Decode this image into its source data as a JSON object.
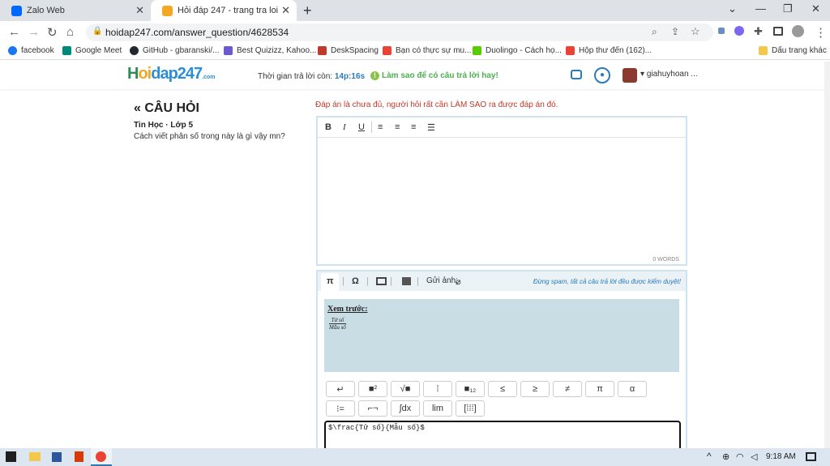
{
  "tabs": [
    {
      "title": "Zalo Web",
      "close": "✕"
    },
    {
      "title": "Hỏi đáp 247 - trang tra loi",
      "close": "✕"
    }
  ],
  "new_tab": "+",
  "window": {
    "minimize": "⌄",
    "dash": "—",
    "restore": "❐",
    "close": "✕"
  },
  "address": {
    "url": "hoidap247.com/answer_question/4628534"
  },
  "bookmarks": [
    {
      "label": "facebook",
      "color": "#1877f2"
    },
    {
      "label": "Google Meet",
      "color": "#00897b"
    },
    {
      "label": "GitHub - gbaranski/...",
      "color": "#24292e"
    },
    {
      "label": "Best Quizizz, Kahoo...",
      "color": "#6a5acd"
    },
    {
      "label": "DeskSpacing",
      "color": "#c0392b"
    },
    {
      "label": "Bạn có thực sự mu...",
      "color": "#ea4335"
    },
    {
      "label": "Duolingo - Cách họ...",
      "color": "#58cc02"
    },
    {
      "label": "Hộp thư đến (162)...",
      "color": "#ea4335"
    },
    {
      "label": "Dấu trang khác",
      "color": "#f2c94c"
    }
  ],
  "site": {
    "logo": {
      "part1": "H",
      "part2": "oi",
      "part3": "dap247",
      "sub": ".com"
    },
    "timer_label": "Thời gian trả lời còn:",
    "timer_value": "14p:16s",
    "tip": "Làm sao để có câu trả lời hay!",
    "username": "giahuyhoan ..."
  },
  "question": {
    "heading": "CÂU HỎI",
    "subject": "Tin Học · Lớp 5",
    "text": "Cách viết phân số trong này là gì vậy mn?"
  },
  "answer": {
    "warning": "Đáp án là chưa đủ, người hỏi rất cần LÀM SAO ra được đáp án đó.",
    "word_count": "0 WORDS"
  },
  "math_panel": {
    "upload_label": "Gửi ảnh:",
    "spam_notice": "Đừng spam, tất cả câu trả lời đều được kiểm duyệt!",
    "preview_label": "Xem trước:",
    "preview_num": "Tử số",
    "preview_den": "Mẫu số",
    "latex": "$\\frac{Tử số}{Mẫu số}$",
    "buttons_row1": [
      "↵",
      "■²",
      "√■",
      "⁞",
      "■₁₂",
      "≤",
      "≥",
      "≠",
      "π",
      "α"
    ],
    "buttons_row2": [
      "⁝=",
      "⌐¬",
      "∫dx",
      "lim",
      "[⁞⁞⁞]"
    ]
  },
  "taskbar": {
    "time": "9:18 AM"
  }
}
